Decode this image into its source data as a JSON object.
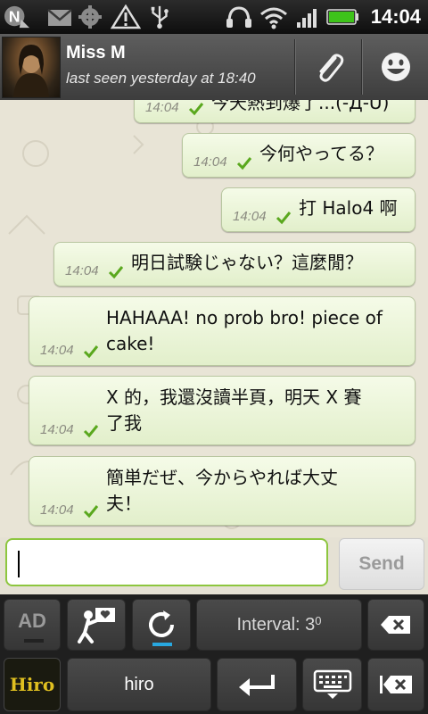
{
  "status_bar": {
    "time": "14:04",
    "icons": [
      "notification-n-icon",
      "gmail-icon",
      "usb-debug-icon",
      "warning-icon",
      "usb-icon",
      "headset-icon",
      "wifi-icon",
      "signal-icon",
      "battery-icon"
    ]
  },
  "header": {
    "contact_name": "Miss M",
    "last_seen": "last seen yesterday at 18:40",
    "icons": [
      "attach-icon",
      "smiley-icon"
    ]
  },
  "messages": [
    {
      "text": "今天熱到爆了...(-Д-U)",
      "time": "14:04"
    },
    {
      "text": "今何やってる？",
      "time": "14:04"
    },
    {
      "text": "打 Halo4 啊",
      "time": "14:04"
    },
    {
      "text": "明日試験じゃない？這麼閒？",
      "time": "14:04"
    },
    {
      "text": "HAHAAA! no prob bro! piece of\ncake!",
      "time": "14:04"
    },
    {
      "text": "X 的，我還沒讀半頁，明天 X 賽\n了我",
      "time": "14:04"
    },
    {
      "text": "簡単だぜ、今からやれば大丈\n夫！",
      "time": "14:04"
    }
  ],
  "composer": {
    "input_value": "",
    "send_label": "Send"
  },
  "keyboard": {
    "interval_label": "Interval: 3",
    "interval_superscript": "0",
    "hiro_key_label": "hiro",
    "logo_text": "Hiro",
    "ad_label": "AD",
    "icons": [
      "ad-icon",
      "person-sign-icon",
      "refresh-icon",
      "backspace-icon",
      "hiro-logo",
      "enter-icon",
      "keyboard-icon",
      "delete-word-icon"
    ]
  },
  "colors": {
    "bubble_top": "#f5fbe8",
    "bubble_bottom": "#e2efcb",
    "check_green": "#5aa81e",
    "input_border": "#8dc63f",
    "refresh_underline": "#28a8e0",
    "logo_yellow": "#e0c020"
  }
}
